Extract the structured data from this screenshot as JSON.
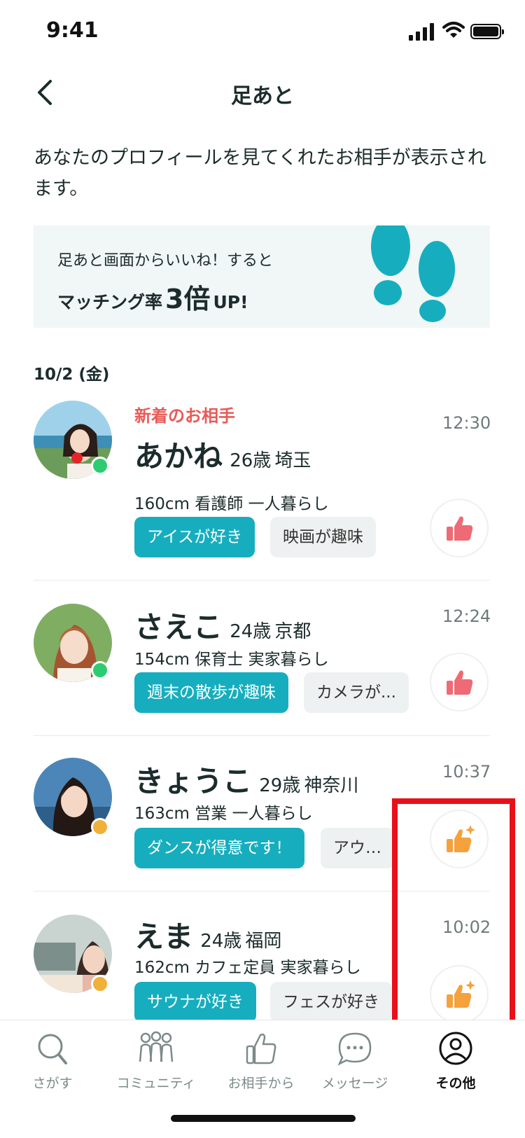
{
  "status_bar": {
    "time": "9:41"
  },
  "header": {
    "title": "足あと",
    "back_icon": "chevron-left-icon"
  },
  "description": "あなたのプロフィールを見てくれたお相手が表示されます。",
  "banner": {
    "line1": "足あと画面からいいね！すると",
    "line2_prefix": "マッチング率",
    "line2_big": "3倍",
    "line2_suffix": "UP!",
    "icon": "footprints-icon",
    "icon_color": "#16aebe"
  },
  "date_header": "10/2 (金)",
  "colors": {
    "accent": "#16aebe",
    "new_label": "#e85a57",
    "like_pink": "#ee6a74",
    "like_orange": "#f5a13c",
    "online": "#2ecc71",
    "away": "#f0b03a",
    "highlight": "#e8101a"
  },
  "users": [
    {
      "new_label": "新着のお相手",
      "name": "あかね",
      "age": "26歳",
      "prefecture": "埼玉",
      "info": "160cm 看護師 一人暮らし",
      "tags": [
        "アイスが好き",
        "映画が趣味"
      ],
      "time": "12:30",
      "status": "online",
      "like_icon": "thumbs-up-icon"
    },
    {
      "new_label": "",
      "name": "さえこ",
      "age": "24歳",
      "prefecture": "京都",
      "info": "154cm 保育士 実家暮らし",
      "tags": [
        "週末の散歩が趣味",
        "カメラが..."
      ],
      "time": "12:24",
      "status": "online",
      "like_icon": "thumbs-up-icon"
    },
    {
      "new_label": "",
      "name": "きょうこ",
      "age": "29歳",
      "prefecture": "神奈川",
      "info": "163cm 営業 一人暮らし",
      "tags": [
        "ダンスが得意です！",
        "アウ…"
      ],
      "time": "10:37",
      "status": "away",
      "like_icon": "thumbs-up-sparkle-icon"
    },
    {
      "new_label": "",
      "name": "えま",
      "age": "24歳",
      "prefecture": "福岡",
      "info": "162cm カフェ定員 実家暮らし",
      "tags": [
        "サウナが好き",
        "フェスが好き"
      ],
      "time": "10:02",
      "status": "away",
      "like_icon": "thumbs-up-sparkle-icon"
    }
  ],
  "tabs": [
    {
      "label": "さがす",
      "icon": "search-icon",
      "active": false
    },
    {
      "label": "コミュニティ",
      "icon": "community-icon",
      "active": false
    },
    {
      "label": "お相手から",
      "icon": "thumbs-up-icon",
      "active": false
    },
    {
      "label": "メッセージ",
      "icon": "chat-bubble-icon",
      "active": false
    },
    {
      "label": "その他",
      "icon": "profile-icon",
      "active": true
    }
  ]
}
